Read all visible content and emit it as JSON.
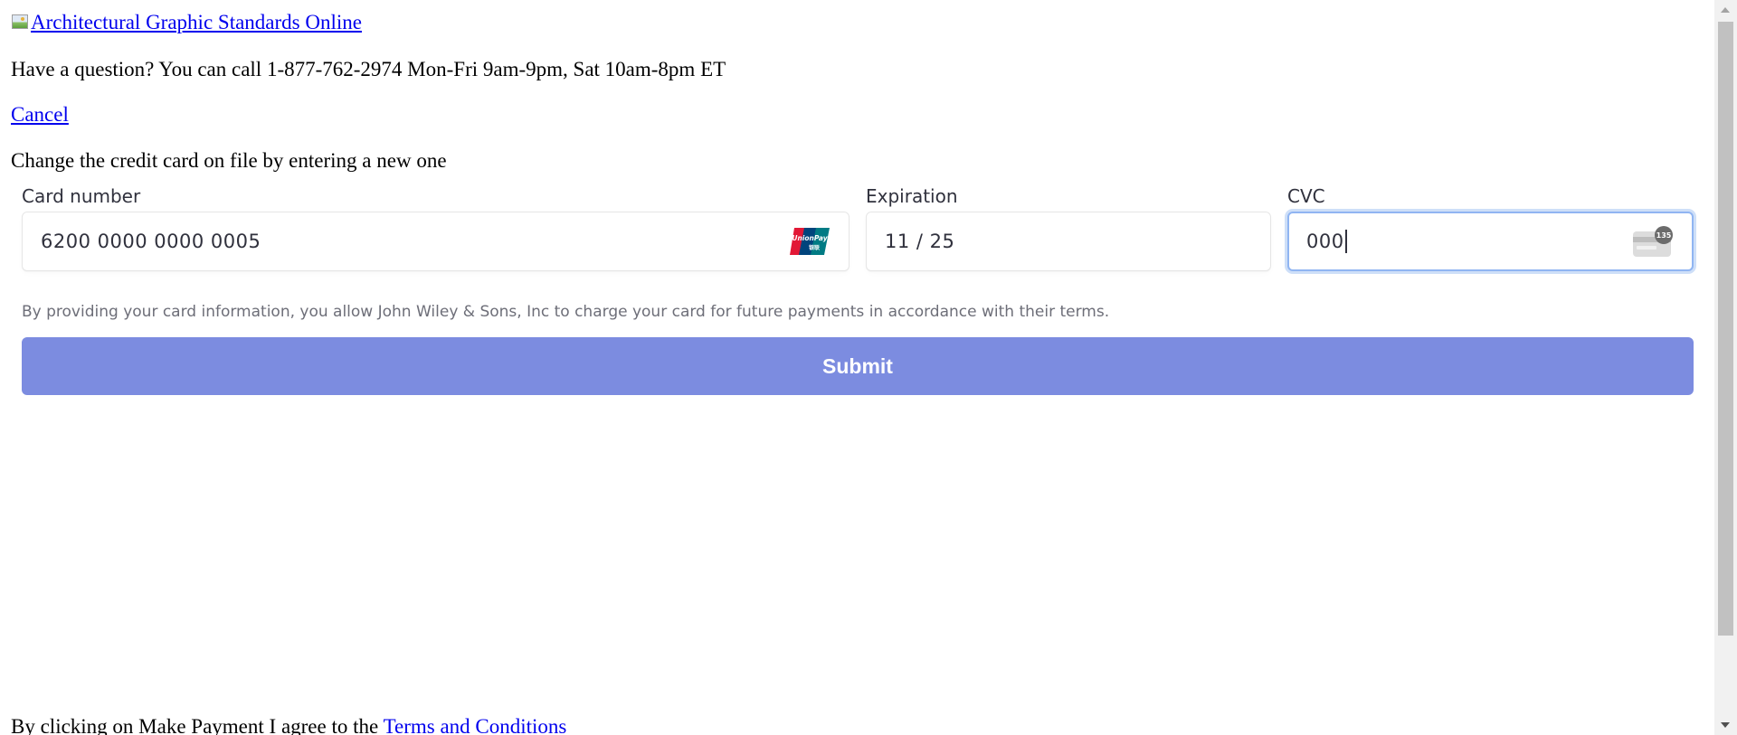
{
  "header": {
    "logo_alt": "Architectural Graphic Standards Online",
    "question_text": "Have a question? You can call 1-877-762-2974 Mon-Fri 9am-9pm, Sat 10am-8pm ET",
    "cancel_label": "Cancel"
  },
  "instructions": "Change the credit card on file by entering a new one",
  "form": {
    "card_number": {
      "label": "Card number",
      "value": "6200 0000 0000 0005",
      "brand_icon": "unionpay-icon"
    },
    "expiration": {
      "label": "Expiration",
      "value": "11 / 25"
    },
    "cvc": {
      "label": "CVC",
      "value": "000",
      "icon": "cvc-card-back-icon",
      "icon_text": "135"
    },
    "consent": "By providing your card information, you allow John Wiley & Sons, Inc to charge your card for future payments in accordance with their terms.",
    "submit_label": "Submit"
  },
  "footer": {
    "agree_prefix": "By clicking on Make Payment I agree to the ",
    "terms_link": "Terms and Conditions"
  },
  "colors": {
    "link": "#0000ee",
    "submit_bg": "#7c8ce0",
    "focus_ring": "#90b5f2",
    "label_text": "#30313d",
    "muted_text": "#6d6e78"
  }
}
